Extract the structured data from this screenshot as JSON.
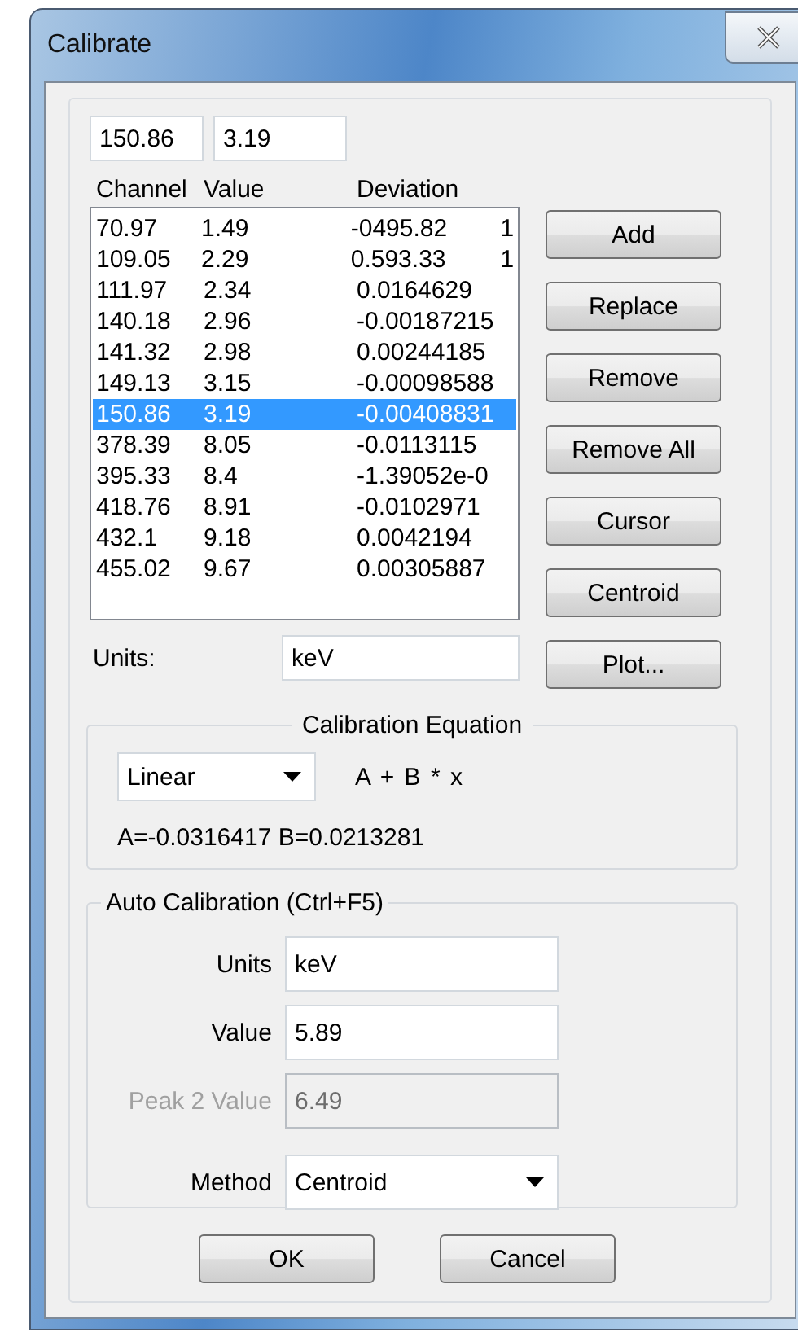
{
  "window": {
    "title": "Calibrate"
  },
  "entry": {
    "channel": "150.86",
    "value": "3.19"
  },
  "list": {
    "columns": [
      "Channel",
      "Value",
      "Deviation"
    ],
    "rows": [
      {
        "channel": "70.97",
        "value": "1.49",
        "deviation": "-0495.82",
        "column_4": "1",
        "selected": false
      },
      {
        "channel": "109.05",
        "value": "2.29",
        "deviation": "0.593.33",
        "column_4": "1",
        "selected": false
      },
      {
        "channel": "111.97",
        "value": "2.34",
        "deviation": "0.0164629",
        "selected": false
      },
      {
        "channel": "140.18",
        "value": "2.96",
        "deviation": "-0.00187215",
        "selected": false
      },
      {
        "channel": "141.32",
        "value": "2.98",
        "deviation": "0.00244185",
        "selected": false
      },
      {
        "channel": "149.13",
        "value": "3.15",
        "deviation": "-0.00098588",
        "selected": false
      },
      {
        "channel": "150.86",
        "value": "3.19",
        "deviation": "-0.00408831",
        "selected": true
      },
      {
        "channel": "378.39",
        "value": "8.05",
        "deviation": "-0.0113115",
        "selected": false
      },
      {
        "channel": "395.33",
        "value": "8.4",
        "deviation": "-1.39052e-0",
        "selected": false
      },
      {
        "channel": "418.76",
        "value": "8.91",
        "deviation": "-0.0102971",
        "selected": false
      },
      {
        "channel": "432.1",
        "value": "9.18",
        "deviation": "0.0042194",
        "selected": false
      },
      {
        "channel": "455.02",
        "value": "9.67",
        "deviation": "0.00305887",
        "selected": false
      }
    ]
  },
  "side_buttons": [
    "Add",
    "Replace",
    "Remove",
    "Remove All",
    "Cursor",
    "Centroid",
    "Plot..."
  ],
  "units": {
    "label": "Units:",
    "value": "keV"
  },
  "calibration_equation": {
    "title": "Calibration Equation",
    "type": "Linear",
    "formula": "A + B * x",
    "coefficients": "A=-0.0316417  B=0.0213281"
  },
  "auto_calibration": {
    "title": "Auto Calibration (Ctrl+F5)",
    "fields": [
      {
        "label": "Units",
        "value": "keV",
        "kind": "text",
        "disabled": false
      },
      {
        "label": "Value",
        "value": "5.89",
        "kind": "text",
        "disabled": false
      },
      {
        "label": "Peak 2 Value",
        "value": "6.49",
        "kind": "text",
        "disabled": true
      },
      {
        "label": "Method",
        "value": "Centroid",
        "kind": "dropdown",
        "disabled": false
      }
    ]
  },
  "buttons": [
    "OK",
    "Cancel"
  ]
}
